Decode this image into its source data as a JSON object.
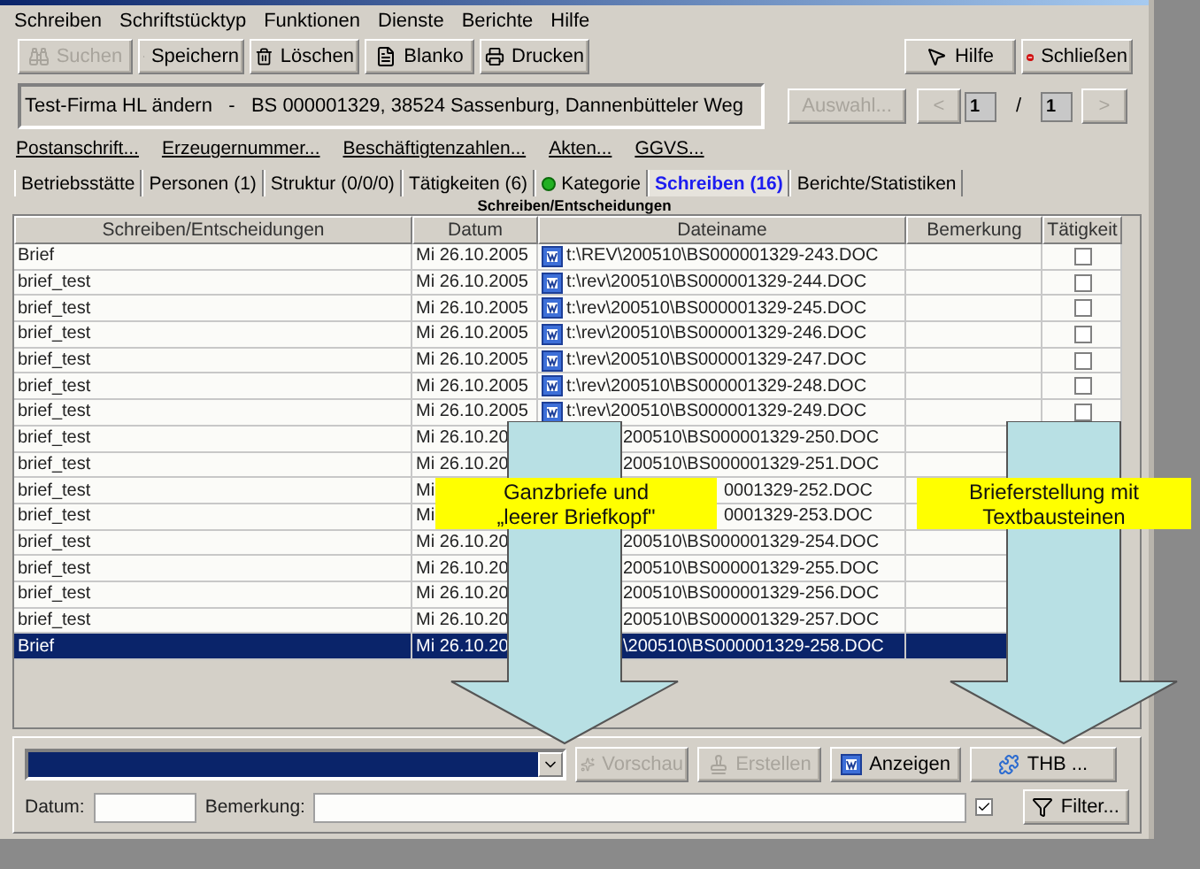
{
  "menu": [
    "Schreiben",
    "Schriftstücktyp",
    "Funktionen",
    "Dienste",
    "Berichte",
    "Hilfe"
  ],
  "toolbar": [
    {
      "label": "Suchen",
      "kind": "search",
      "disabled": true
    },
    {
      "label": "Speichern",
      "kind": "save",
      "disabled": false
    },
    {
      "label": "Löschen",
      "kind": "delete",
      "disabled": false
    },
    {
      "label": "Blanko",
      "kind": "blank",
      "disabled": false
    },
    {
      "label": "Drucken",
      "kind": "print",
      "disabled": false
    }
  ],
  "toolbar_right": [
    {
      "label": "Hilfe",
      "kind": "help"
    },
    {
      "label": "Schließen",
      "kind": "close"
    }
  ],
  "record": {
    "text": "Test-Firma HL ändern   -   BS 000001329, 38524 Sassenburg, Dannenbütteler Weg"
  },
  "select_button": {
    "label": "Auswahl...",
    "disabled": true
  },
  "pager": {
    "prev": "<",
    "current": "1",
    "separator": "/",
    "total": "1",
    "next": ">",
    "disabled": true
  },
  "links": [
    "Postanschrift...",
    "Erzeugernummer...",
    "Beschäftigtenzahlen...",
    "Akten...",
    "GGVS..."
  ],
  "tabs": [
    {
      "label": "Betriebsstätte",
      "selected": false,
      "status_dot": false
    },
    {
      "label": "Personen (1)",
      "selected": false,
      "status_dot": false
    },
    {
      "label": "Struktur (0/0/0)",
      "selected": false,
      "status_dot": false
    },
    {
      "label": "Tätigkeiten (6)",
      "selected": false,
      "status_dot": false
    },
    {
      "label": "Kategorie",
      "selected": false,
      "status_dot": true
    },
    {
      "label": "Schreiben (16)",
      "selected": true,
      "status_dot": false
    },
    {
      "label": "Berichte/Statistiken",
      "selected": false,
      "status_dot": false
    }
  ],
  "table": {
    "title": "Schreiben/Entscheidungen",
    "columns": [
      "Schreiben/Entscheidungen",
      "Datum",
      "Dateiname",
      "Bemerkung",
      "Tätigkeit"
    ],
    "rows": [
      {
        "name": "Brief",
        "date": "Mi 26.10.2005",
        "file": "t:\\REV\\200510\\BS000001329-243.DOC",
        "file_icon": true,
        "under_callout": false,
        "checked": false,
        "selected": false
      },
      {
        "name": "brief_test",
        "date": "Mi 26.10.2005",
        "file": "t:\\rev\\200510\\BS000001329-244.DOC",
        "file_icon": true,
        "under_callout": false,
        "checked": false,
        "selected": false
      },
      {
        "name": "brief_test",
        "date": "Mi 26.10.2005",
        "file": "t:\\rev\\200510\\BS000001329-245.DOC",
        "file_icon": true,
        "under_callout": false,
        "checked": false,
        "selected": false
      },
      {
        "name": "brief_test",
        "date": "Mi 26.10.2005",
        "file": "t:\\rev\\200510\\BS000001329-246.DOC",
        "file_icon": true,
        "under_callout": false,
        "checked": false,
        "selected": false
      },
      {
        "name": "brief_test",
        "date": "Mi 26.10.2005",
        "file": "t:\\rev\\200510\\BS000001329-247.DOC",
        "file_icon": true,
        "under_callout": false,
        "checked": false,
        "selected": false
      },
      {
        "name": "brief_test",
        "date": "Mi 26.10.2005",
        "file": "t:\\rev\\200510\\BS000001329-248.DOC",
        "file_icon": true,
        "under_callout": false,
        "checked": false,
        "selected": false
      },
      {
        "name": "brief_test",
        "date": "Mi 26.10.2005",
        "file": "t:\\rev\\200510\\BS000001329-249.DOC",
        "file_icon": true,
        "under_callout": false,
        "checked": false,
        "selected": false
      },
      {
        "name": "brief_test",
        "date": "Mi 26.10.20",
        "file": "200510\\BS000001329-250.DOC",
        "file_icon": false,
        "under_callout": false,
        "selected": false
      },
      {
        "name": "brief_test",
        "date": "Mi 26.10.20",
        "file": "200510\\BS000001329-251.DOC",
        "file_icon": false,
        "under_callout": false,
        "selected": false
      },
      {
        "name": "brief_test",
        "date": "Mi",
        "file": "0001329-252.DOC",
        "file_icon": false,
        "under_callout": true,
        "selected": false
      },
      {
        "name": "brief_test",
        "date": "Mi",
        "file": "0001329-253.DOC",
        "file_icon": false,
        "under_callout": true,
        "selected": false
      },
      {
        "name": "brief_test",
        "date": "Mi 26.10.20",
        "file": "200510\\BS000001329-254.DOC",
        "file_icon": false,
        "under_callout": false,
        "selected": false
      },
      {
        "name": "brief_test",
        "date": "Mi 26.10.20",
        "file": "200510\\BS000001329-255.DOC",
        "file_icon": false,
        "under_callout": false,
        "selected": false
      },
      {
        "name": "brief_test",
        "date": "Mi 26.10.20",
        "file": "200510\\BS000001329-256.DOC",
        "file_icon": false,
        "under_callout": false,
        "selected": false
      },
      {
        "name": "brief_test",
        "date": "Mi 26.10.20",
        "file": "200510\\BS000001329-257.DOC",
        "file_icon": false,
        "under_callout": false,
        "selected": false
      },
      {
        "name": "Brief",
        "date": "Mi 26.10.20",
        "file": "\\200510\\BS000001329-258.DOC",
        "file_icon": false,
        "under_callout": false,
        "selected": true
      }
    ]
  },
  "bottom": {
    "buttons": [
      {
        "label": "Vorschau",
        "kind": "preview",
        "disabled": true
      },
      {
        "label": "Erstellen",
        "kind": "create",
        "disabled": true
      },
      {
        "label": "Anzeigen",
        "kind": "show",
        "disabled": false
      },
      {
        "label": "THB ...",
        "kind": "thb",
        "disabled": false
      }
    ],
    "date_label": "Datum:",
    "remark_label": "Bemerkung:",
    "filter_checked": true,
    "filter_button": "Filter..."
  },
  "annotations": [
    {
      "lines": [
        "Ganzbriefe und",
        "„leerer Briefkopf\""
      ]
    },
    {
      "lines": [
        "Brieferstellung mit",
        "Textbausteinen"
      ]
    }
  ]
}
